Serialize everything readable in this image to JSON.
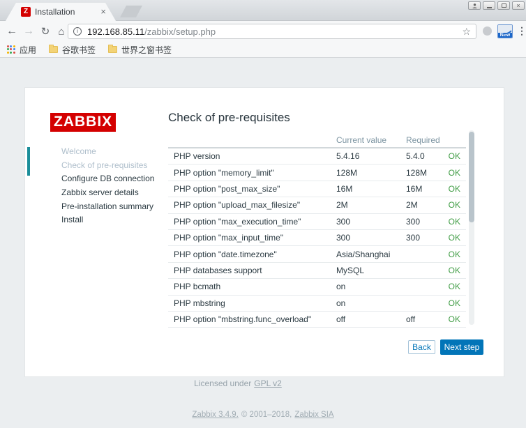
{
  "browser": {
    "tab": {
      "title": "Installation",
      "favicon_letter": "Z"
    },
    "window_controls": {
      "profile": "person-icon",
      "minimize": "minimize-icon",
      "maximize": "maximize-icon",
      "close": "close-icon"
    },
    "address": {
      "host": "192.168.85.11",
      "path": "/zabbix/setup.php"
    },
    "bookmarks": [
      {
        "label": "应用",
        "icon": "apps-grid-icon"
      },
      {
        "label": "谷歌书签",
        "icon": "folder-icon"
      },
      {
        "label": "世界之窗书签",
        "icon": "folder-icon"
      }
    ],
    "new_extension_label": "New",
    "apps_grid_colors": [
      "#da4f44",
      "#4285f4",
      "#f4b400",
      "#34a853",
      "#da4f44",
      "#4285f4",
      "#f4b400",
      "#34a853",
      "#da4f44"
    ]
  },
  "icons": {
    "back": "←",
    "forward": "→",
    "reload": "↻",
    "home": "⌂",
    "info": "i",
    "star": "☆",
    "menu": "⋮",
    "tab_close": "×",
    "window_close": "×"
  },
  "page": {
    "logo_text": "ZABBIX",
    "heading": "Check of pre-requisites",
    "sidebar": {
      "items": [
        {
          "label": "Welcome",
          "state": "done"
        },
        {
          "label": "Check of pre-requisites",
          "state": "current"
        },
        {
          "label": "Configure DB connection",
          "state": "todo"
        },
        {
          "label": "Zabbix server details",
          "state": "todo"
        },
        {
          "label": "Pre-installation summary",
          "state": "todo"
        },
        {
          "label": "Install",
          "state": "todo"
        }
      ]
    },
    "table": {
      "headers": {
        "current": "Current value",
        "required": "Required"
      },
      "rows": [
        {
          "name": "PHP version",
          "current": "5.4.16",
          "required": "5.4.0",
          "status": "OK"
        },
        {
          "name": "PHP option \"memory_limit\"",
          "current": "128M",
          "required": "128M",
          "status": "OK"
        },
        {
          "name": "PHP option \"post_max_size\"",
          "current": "16M",
          "required": "16M",
          "status": "OK"
        },
        {
          "name": "PHP option \"upload_max_filesize\"",
          "current": "2M",
          "required": "2M",
          "status": "OK"
        },
        {
          "name": "PHP option \"max_execution_time\"",
          "current": "300",
          "required": "300",
          "status": "OK"
        },
        {
          "name": "PHP option \"max_input_time\"",
          "current": "300",
          "required": "300",
          "status": "OK"
        },
        {
          "name": "PHP option \"date.timezone\"",
          "current": "Asia/Shanghai",
          "required": "",
          "status": "OK"
        },
        {
          "name": "PHP databases support",
          "current": "MySQL",
          "required": "",
          "status": "OK"
        },
        {
          "name": "PHP bcmath",
          "current": "on",
          "required": "",
          "status": "OK"
        },
        {
          "name": "PHP mbstring",
          "current": "on",
          "required": "",
          "status": "OK"
        },
        {
          "name": "PHP option \"mbstring.func_overload\"",
          "current": "off",
          "required": "off",
          "status": "OK"
        }
      ]
    },
    "buttons": {
      "back": "Back",
      "next": "Next step"
    },
    "footer": {
      "license_prefix": "Licensed under",
      "license_link": "GPL v2",
      "version_link": "Zabbix 3.4.9.",
      "copyright_mid": "© 2001–2018,",
      "company_link": "Zabbix SIA"
    }
  },
  "colors": {
    "zabbix_red": "#d40000",
    "accent_teal": "#1b8e9a",
    "ok_green": "#3f9c44",
    "button_blue": "#0275b8",
    "page_bg": "#ebeef0"
  }
}
